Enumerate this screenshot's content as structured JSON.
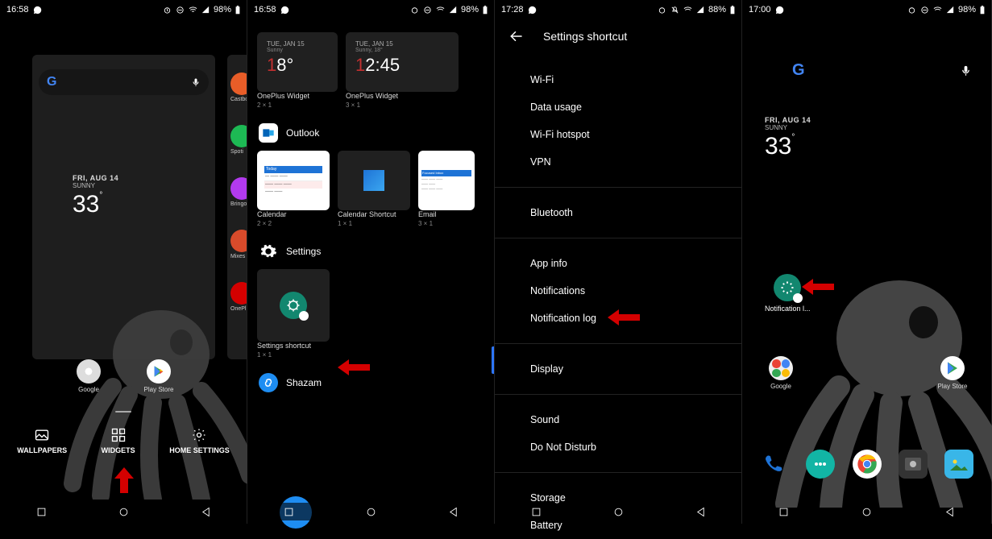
{
  "status": {
    "p1": {
      "time": "16:58",
      "battery": "98%"
    },
    "p2": {
      "time": "16:58",
      "battery": "98%"
    },
    "p3": {
      "time": "17:28",
      "battery": "88%"
    },
    "p4": {
      "time": "17:00",
      "battery": "98%"
    }
  },
  "p1": {
    "weather": {
      "date": "FRI, AUG 14",
      "cond": "SUNNY",
      "temp": "33"
    },
    "apps": [
      {
        "label": "Google"
      },
      {
        "label": "Play Store"
      }
    ],
    "side_labels": [
      "Castbo",
      "Spoti",
      "Bringo",
      "Mixes",
      "OnePl"
    ],
    "opts": {
      "wallpapers": "WALLPAPERS",
      "widgets": "WIDGETS",
      "home": "HOME SETTINGS"
    }
  },
  "p2": {
    "oneplus": {
      "date": "TUE, JAN 15",
      "cond": "Sunny",
      "temp_card": {
        "temp": "18°",
        "label": "OnePlus Widget",
        "size": "2 × 1"
      },
      "clock_card": {
        "hi": "18°",
        "time": "12:45",
        "label": "OnePlus Widget",
        "size": "3 × 1"
      }
    },
    "outlook": {
      "header": "Outlook",
      "items": [
        {
          "label": "Calendar",
          "size": "2 × 2"
        },
        {
          "label": "Calendar Shortcut",
          "size": "1 × 1"
        },
        {
          "label": "Email",
          "size": "3 × 1"
        }
      ]
    },
    "settings": {
      "header": "Settings",
      "shortcut_label": "Settings shortcut",
      "shortcut_size": "1 × 1"
    },
    "shazam": {
      "header": "Shazam"
    }
  },
  "p3": {
    "title": "Settings shortcut",
    "items_a": [
      "Wi-Fi",
      "Data usage",
      "Wi-Fi hotspot",
      "VPN"
    ],
    "items_b": [
      "Bluetooth"
    ],
    "items_c": [
      "App info",
      "Notifications",
      "Notification log"
    ],
    "items_d": [
      "Display"
    ],
    "items_e": [
      "Sound",
      "Do Not Disturb"
    ],
    "items_f": [
      "Storage",
      "Battery"
    ]
  },
  "p4": {
    "weather": {
      "date": "FRI, AUG 14",
      "cond": "SUNNY",
      "temp": "33"
    },
    "shortcut_label": "Notification l...",
    "apps": [
      {
        "label": "Google"
      },
      {
        "label": "Play Store"
      }
    ]
  }
}
